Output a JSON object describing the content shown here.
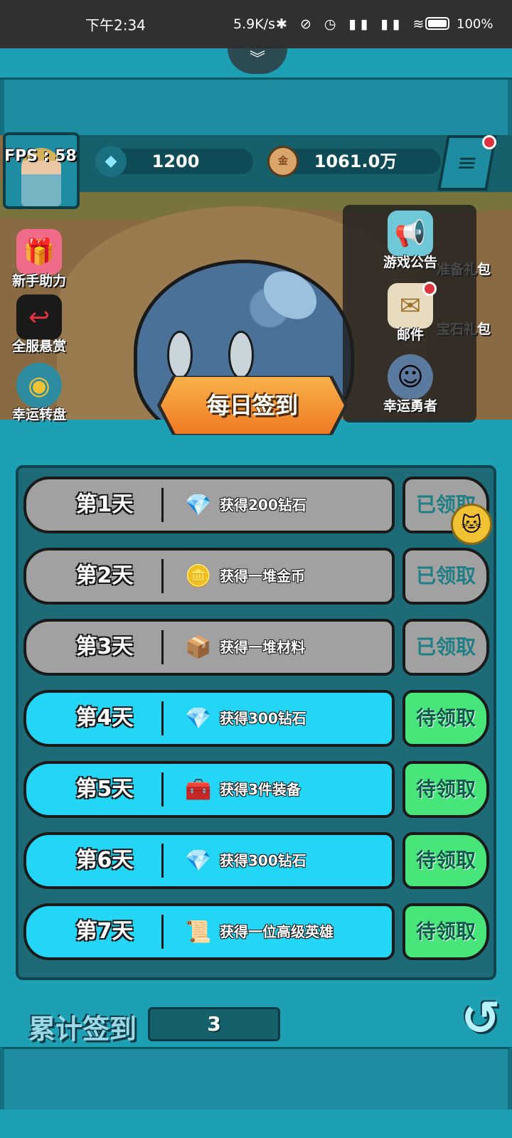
{
  "status_bar": {
    "time": "下午2:34",
    "network_speed": "5.9K/s",
    "icons": "✱ ⊘ ◷ ▮▮ ▮▮ ≋",
    "battery": "100%"
  },
  "hud": {
    "fps": "FPS : 58",
    "diamonds": "1200",
    "gold": "1061.0万",
    "gold_icon": "金",
    "diamond_icon": "gem-icon"
  },
  "left_menu": [
    {
      "label": "新手助力",
      "icon": "🎁"
    },
    {
      "label": "全服悬赏",
      "icon": "↩"
    },
    {
      "label": "幸运转盘",
      "icon": "◉"
    }
  ],
  "right_menu": [
    {
      "label": "游戏公告",
      "icon": "📢"
    },
    {
      "label": "邮件",
      "icon": "✉"
    },
    {
      "label": "幸运勇者",
      "icon": "☺"
    }
  ],
  "behind_labels": [
    "准备礼包",
    "宝石礼包"
  ],
  "banner_title": "每日签到",
  "signin": [
    {
      "day": "第1天",
      "reward": "获得200钻石",
      "icon": "💎",
      "status": "已领取",
      "claimed": true
    },
    {
      "day": "第2天",
      "reward": "获得一堆金币",
      "icon": "🪙",
      "status": "已领取",
      "claimed": true
    },
    {
      "day": "第3天",
      "reward": "获得一堆材料",
      "icon": "📦",
      "status": "已领取",
      "claimed": true
    },
    {
      "day": "第4天",
      "reward": "获得300钻石",
      "icon": "💎",
      "status": "待领取",
      "claimed": false
    },
    {
      "day": "第5天",
      "reward": "获得3件装备",
      "icon": "🧰",
      "status": "待领取",
      "claimed": false
    },
    {
      "day": "第6天",
      "reward": "获得300钻石",
      "icon": "💎",
      "status": "待领取",
      "claimed": false
    },
    {
      "day": "第7天",
      "reward": "获得一位高级英雄",
      "icon": "📜",
      "status": "待领取",
      "claimed": false
    }
  ],
  "cumulative": {
    "label": "累计签到",
    "value": "3"
  },
  "colors": {
    "teal": "#1d9fb4",
    "claimed_gray": "#a1a1a1",
    "pending_cyan": "#23d6f5",
    "pending_green": "#48e67a",
    "banner_orange": "#ef7a23"
  }
}
